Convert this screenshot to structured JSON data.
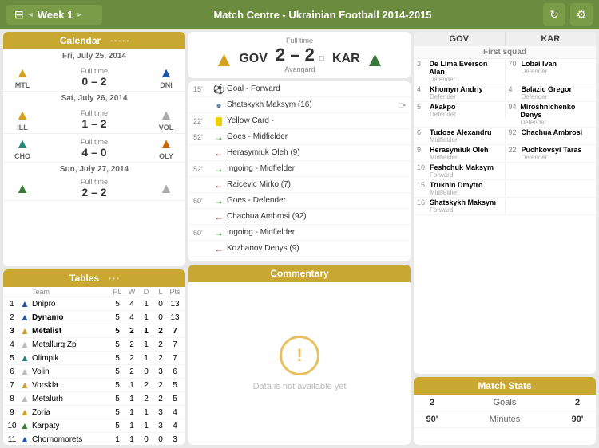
{
  "topbar": {
    "filter_icon": "⊟",
    "week_label": "Week 1",
    "chevron": "▾",
    "title": "Match Centre - Ukrainian Football 2014-2015",
    "refresh_icon": "↻",
    "settings_icon": "⚙"
  },
  "calendar": {
    "title": "Calendar",
    "dots": "• • • • •",
    "dates": [
      {
        "date": "Fri, July 25, 2014",
        "matches": [
          {
            "time_label": "Full time",
            "score": "0 – 2",
            "home": "MTL",
            "away": "DNI",
            "home_shirt": "yellow",
            "away_shirt": "blue"
          }
        ]
      },
      {
        "date": "Sat, July 26, 2014",
        "matches": [
          {
            "time_label": "Full time",
            "score": "1 – 2",
            "home": "ILL",
            "away": "VOL",
            "home_shirt": "yellow",
            "away_shirt": "white"
          },
          {
            "time_label": "Full time",
            "score": "4 – 0",
            "home": "CHO",
            "away": "OLY",
            "home_shirt": "blue",
            "away_shirt": "orange"
          }
        ]
      },
      {
        "date": "Sun, July 27, 2014",
        "matches": [
          {
            "time_label": "Full time",
            "score": "2 – 2",
            "home": "",
            "away": "",
            "home_shirt": "green",
            "away_shirt": "white"
          }
        ]
      }
    ]
  },
  "tables": {
    "title": "Tables",
    "dots": "• • •",
    "header": [
      "Team",
      "PL",
      "W",
      "D",
      "L",
      "Pts"
    ],
    "rows": [
      {
        "rank": "1",
        "name": "Dnipro",
        "shirt": "blue",
        "pl": 5,
        "w": 4,
        "d": 1,
        "l": 0,
        "pts": 13,
        "bold": false
      },
      {
        "rank": "2",
        "name": "Dynamo",
        "shirt": "blue",
        "pl": 5,
        "w": 4,
        "d": 1,
        "l": 0,
        "pts": 13,
        "bold": false
      },
      {
        "rank": "3",
        "name": "Metalist",
        "shirt": "yellow",
        "pl": 5,
        "w": 2,
        "d": 1,
        "l": 2,
        "pts": 7,
        "bold": true
      },
      {
        "rank": "4",
        "name": "Metallurg Zp",
        "shirt": "white",
        "pl": 5,
        "w": 2,
        "d": 1,
        "l": 2,
        "pts": 7,
        "bold": false
      },
      {
        "rank": "5",
        "name": "Olimpik",
        "shirt": "white",
        "pl": 5,
        "w": 2,
        "d": 1,
        "l": 2,
        "pts": 7,
        "bold": false
      },
      {
        "rank": "6",
        "name": "Volin'",
        "shirt": "white",
        "pl": 5,
        "w": 2,
        "d": 0,
        "l": 3,
        "pts": 6,
        "bold": false
      },
      {
        "rank": "7",
        "name": "Vorskla",
        "shirt": "white",
        "pl": 5,
        "w": 1,
        "d": 2,
        "l": 2,
        "pts": 5,
        "bold": false
      },
      {
        "rank": "8",
        "name": "Metalurh",
        "shirt": "white",
        "pl": 5,
        "w": 1,
        "d": 2,
        "l": 2,
        "pts": 5,
        "bold": false
      },
      {
        "rank": "9",
        "name": "Zoria",
        "shirt": "yellow",
        "pl": 5,
        "w": 1,
        "d": 1,
        "l": 3,
        "pts": 4,
        "bold": false
      },
      {
        "rank": "10",
        "name": "Karpaty",
        "shirt": "green",
        "pl": 5,
        "w": 1,
        "d": 1,
        "l": 3,
        "pts": 4,
        "bold": false
      },
      {
        "rank": "11",
        "name": "Chornomorets",
        "shirt": "blue",
        "pl": 1,
        "w": 1,
        "d": 0,
        "l": 0,
        "pts": 3,
        "bold": false
      }
    ]
  },
  "match": {
    "status": "Full time",
    "home_team": "GOV",
    "away_team": "KAR",
    "score": "2 – 2",
    "card_icon": "□",
    "subtitle": "Avangard",
    "home_shirt": "yellow",
    "away_shirt": "green",
    "events": [
      {
        "time": "15'",
        "type": "goal",
        "desc": "Goal - Forward",
        "icon": "⚽"
      },
      {
        "time": "",
        "type": "sub",
        "desc": "Shatskykh Maksym (16)",
        "icon": "🔄",
        "right": "□▪"
      },
      {
        "time": "22'",
        "type": "card",
        "desc": "Yellow Card -",
        "icon": "🟨"
      },
      {
        "time": "52'",
        "type": "arrow_in",
        "desc": "Goes - Midfielder",
        "icon": "→"
      },
      {
        "time": "",
        "type": "arrow_out",
        "desc": "Herasymiuk Oleh (9)",
        "icon": "←"
      },
      {
        "time": "52'",
        "type": "arrow_in",
        "desc": "Ingoing - Midfielder",
        "icon": "→"
      },
      {
        "time": "",
        "type": "arrow_out",
        "desc": "Raicevic Mirko (7)",
        "icon": "←"
      },
      {
        "time": "60'",
        "type": "arrow_in",
        "desc": "Goes - Defender",
        "icon": "→"
      },
      {
        "time": "",
        "type": "arrow_out",
        "desc": "Chachua Ambrosi (92)",
        "icon": "←"
      },
      {
        "time": "60'",
        "type": "arrow_in",
        "desc": "Ingoing - Midfielder",
        "icon": "→"
      },
      {
        "time": "",
        "type": "arrow_out",
        "desc": "Kozhanov Denys (9)",
        "icon": "←"
      }
    ]
  },
  "commentary": {
    "title": "Commentary",
    "warning_icon": "!",
    "no_data": "Data is not available yet"
  },
  "squads": {
    "home_team": "GOV",
    "away_team": "KAR",
    "section_title": "First squad",
    "players": [
      {
        "num": "3",
        "name": "De Lima Everson Alan",
        "pos": "Defender",
        "side": "home",
        "pair_num": "70",
        "pair_name": "Lobai Ivan",
        "pair_pos": "Defender"
      },
      {
        "num": "4",
        "name": "Khomyn Andriy",
        "pos": "Defender",
        "side": "home",
        "pair_num": "4",
        "pair_name": "Balazic Gregor",
        "pair_pos": "Defender"
      },
      {
        "num": "5",
        "name": "Akakpo",
        "pos": "Defender",
        "side": "home",
        "pair_num": "94",
        "pair_name": "Miroshnichenko Denys",
        "pair_pos": "Defender"
      },
      {
        "num": "6",
        "name": "Tudose Alexandru",
        "pos": "Midfielder",
        "side": "home",
        "pair_num": "92",
        "pair_name": "Chachua Ambrosi",
        "pair_pos": ""
      },
      {
        "num": "9",
        "name": "Herasymiuk Oleh",
        "pos": "Midfielder",
        "side": "home",
        "pair_num": "22",
        "pair_name": "Puchkovsyi Taras",
        "pair_pos": "Defender"
      },
      {
        "num": "10",
        "name": "Feshchuk Maksym",
        "pos": "Forward",
        "side": "home",
        "pair_num": "",
        "pair_name": "",
        "pair_pos": ""
      },
      {
        "num": "15",
        "name": "Trukhin Dmytro",
        "pos": "Midfielder",
        "side": "home",
        "pair_num": "",
        "pair_name": "",
        "pair_pos": ""
      },
      {
        "num": "16",
        "name": "Shatskykh Maksym",
        "pos": "Forward",
        "side": "home",
        "pair_num": "",
        "pair_name": "",
        "pair_pos": ""
      }
    ]
  },
  "match_stats": {
    "title": "Match Stats",
    "rows": [
      {
        "left": "2",
        "label": "Goals",
        "right": "2"
      },
      {
        "left": "90'",
        "label": "Minutes",
        "right": "90'"
      }
    ]
  }
}
